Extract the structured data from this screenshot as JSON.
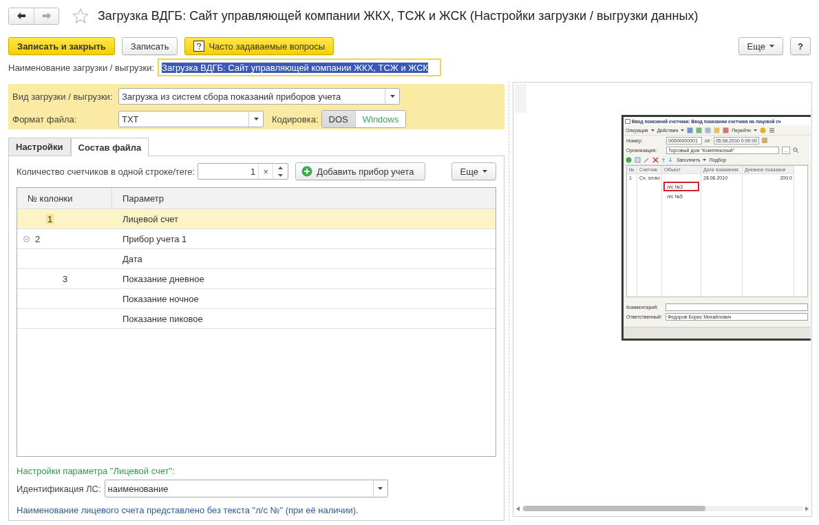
{
  "window": {
    "title": "Загрузка ВДГБ: Сайт управляющей компании ЖКХ, ТСЖ и ЖСК (Настройки загрузки / выгрузки данных)"
  },
  "toolbar": {
    "buttons": [
      {
        "label": "Записать и закрыть",
        "kind": "primary"
      },
      {
        "label": "Записать",
        "kind": "plain"
      },
      {
        "label": "Часто задаваемые вопросы",
        "kind": "help"
      }
    ],
    "more": "Еще",
    "help": "?"
  },
  "name_field": {
    "label": "Наименование загрузки / выгрузки:",
    "value": "Загрузка ВДГБ: Сайт управляющей компании ЖКХ, ТСЖ и ЖСК",
    "focused": true
  },
  "settings": {
    "type": {
      "label": "Вид загрузки / выгрузки:",
      "value": "Загрузка из систем сбора показаний приборов учета"
    },
    "format": {
      "label": "Формат файла:",
      "value": "TXT"
    },
    "encoding": {
      "label": "Кодировка:",
      "options": [
        {
          "label": "DOS",
          "selected": true
        },
        {
          "label": "Windows",
          "selected": false
        }
      ]
    }
  },
  "tabs": [
    {
      "label": "Настройки",
      "selected": false
    },
    {
      "label": "Состав файла",
      "selected": true
    }
  ],
  "count": {
    "label": "Количество счетчиков в одной строке/теге:",
    "value": "1",
    "clear": "×"
  },
  "add_button": "Добавить прибор учета",
  "more": "Еще",
  "table": {
    "columns": [
      "№ колонки",
      "Параметр"
    ],
    "rows": [
      {
        "column": "1",
        "parameter": "Лицевой счет",
        "selected": true
      },
      {
        "column": "2",
        "parameter": "Прибор учета 1",
        "selected": false,
        "expanded": true,
        "children": [
          {
            "parameter": "Дата",
            "selected": false
          },
          {
            "column": "3",
            "parameter": "Показание дневное",
            "selected": false
          },
          {
            "parameter": "Показание ночное",
            "selected": false
          },
          {
            "parameter": "Показание пиковое",
            "selected": false
          }
        ]
      }
    ]
  },
  "param_settings": {
    "title": "Настройки параметра \"Лицевой счет\":",
    "field": {
      "label": "Идентификация ЛС:",
      "value": "наименование"
    },
    "note": "Наименование лицевого счета представлено без текста \"л/с №\" (при её наличии)."
  },
  "preview": {
    "title": "Ввод показаний счетчика: Ввод показании счетчика на лицевой сч",
    "menus": [
      "Операция",
      "Действия",
      "Перейти"
    ],
    "number_label": "Номер:",
    "number": "00000000001",
    "date_label": "от:",
    "date": "05.06.2010 0:00:00",
    "org_label": "Организация:",
    "org": "Торговый дом \"Комплексный\"",
    "org_button": "...",
    "fill": "Заполнить",
    "pick": "Подбор",
    "columns": [
      "№",
      "Счетчик",
      "Объект",
      "Дата показания",
      "Дневное показани"
    ],
    "rows": [
      {
        "cells": [
          "1",
          "Сч. эл-во",
          "",
          "28.06.2010",
          "200.0"
        ]
      }
    ],
    "dropdown": [
      {
        "label": "л/с №3",
        "selected": true
      },
      {
        "label": "л/с №5",
        "selected": false
      }
    ],
    "comment_label": "Комментарий:",
    "responsible_label": "Ответственный:",
    "responsible": "Федоров Борис Михайлович"
  }
}
